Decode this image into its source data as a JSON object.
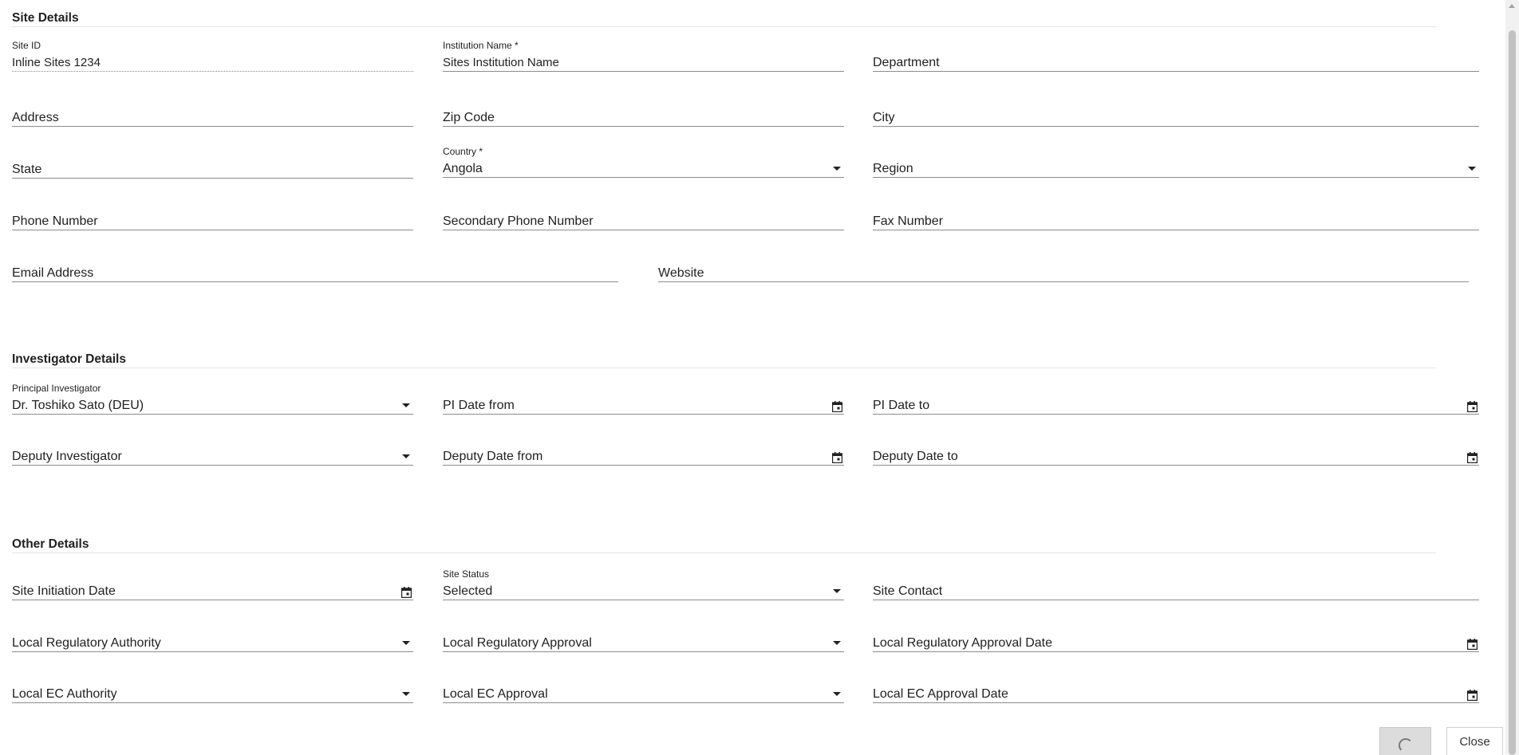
{
  "sections": {
    "site": "Site Details",
    "investigator": "Investigator Details",
    "other": "Other Details"
  },
  "fields": {
    "site_id": {
      "label": "Site ID",
      "value": "Inline Sites 1234"
    },
    "institution_name": {
      "label": "Institution Name *",
      "value": "Sites Institution Name"
    },
    "department": {
      "placeholder": "Department"
    },
    "address": {
      "placeholder": "Address"
    },
    "zip_code": {
      "placeholder": "Zip Code"
    },
    "city": {
      "placeholder": "City"
    },
    "state": {
      "placeholder": "State"
    },
    "country": {
      "label": "Country *",
      "value": "Angola"
    },
    "region": {
      "placeholder": "Region"
    },
    "phone": {
      "placeholder": "Phone Number"
    },
    "secondary_phone": {
      "placeholder": "Secondary Phone Number"
    },
    "fax": {
      "placeholder": "Fax Number"
    },
    "email": {
      "placeholder": "Email Address"
    },
    "website": {
      "placeholder": "Website"
    },
    "principal_investigator": {
      "label": "Principal Investigator",
      "value": "Dr. Toshiko Sato (DEU)"
    },
    "pi_date_from": {
      "placeholder": "PI Date from"
    },
    "pi_date_to": {
      "placeholder": "PI Date to"
    },
    "deputy_investigator": {
      "placeholder": "Deputy Investigator"
    },
    "deputy_date_from": {
      "placeholder": "Deputy Date from"
    },
    "deputy_date_to": {
      "placeholder": "Deputy Date to"
    },
    "site_initiation_date": {
      "placeholder": "Site Initiation Date"
    },
    "site_status": {
      "label": "Site Status",
      "value": "Selected"
    },
    "site_contact": {
      "placeholder": "Site Contact"
    },
    "local_reg_authority": {
      "placeholder": "Local Regulatory Authority"
    },
    "local_reg_approval": {
      "placeholder": "Local Regulatory Approval"
    },
    "local_reg_approval_date": {
      "placeholder": "Local Regulatory Approval Date"
    },
    "local_ec_authority": {
      "placeholder": "Local EC Authority"
    },
    "local_ec_approval": {
      "placeholder": "Local EC Approval"
    },
    "local_ec_approval_date": {
      "placeholder": "Local EC Approval Date"
    }
  },
  "buttons": {
    "close": "Close"
  },
  "icons": {
    "dropdown": "chevron-down-icon",
    "calendar": "calendar-icon",
    "spinner": "loading-spinner-icon"
  }
}
